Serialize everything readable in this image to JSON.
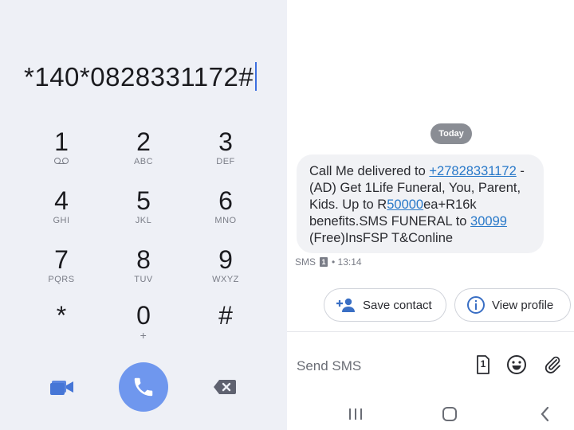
{
  "dialer": {
    "number": "*140*0828331172#",
    "keys": [
      {
        "digit": "1",
        "letters": ""
      },
      {
        "digit": "2",
        "letters": "ABC"
      },
      {
        "digit": "3",
        "letters": "DEF"
      },
      {
        "digit": "4",
        "letters": "GHI"
      },
      {
        "digit": "5",
        "letters": "JKL"
      },
      {
        "digit": "6",
        "letters": "MNO"
      },
      {
        "digit": "7",
        "letters": "PQRS"
      },
      {
        "digit": "8",
        "letters": "TUV"
      },
      {
        "digit": "9",
        "letters": "WXYZ"
      },
      {
        "digit": "*",
        "letters": ""
      },
      {
        "digit": "0",
        "letters": "+"
      },
      {
        "digit": "#",
        "letters": ""
      }
    ],
    "icons": {
      "voicemail": "voicemail-icon",
      "video": "video-call-icon",
      "call": "phone-call-icon",
      "delete": "backspace-icon"
    },
    "colors": {
      "call_button": "#6f97ee",
      "accent": "#3c6fe0"
    }
  },
  "sms": {
    "date_chip": "Today",
    "message": {
      "part1": "Call Me delivered to ",
      "link1": "+27828331172",
      "part2": " -(AD) Get 1Life Funeral, You, Parent, Kids. Up to R",
      "link2": "50000",
      "part3": "ea+R16k benefits.SMS FUNERAL to ",
      "link3": "30099",
      "part4": " (Free)InsFSP T&Conline"
    },
    "meta": {
      "type": "SMS",
      "sim": "1",
      "time": "• 13:14"
    },
    "actions": {
      "save_contact": "Save contact",
      "view_profile": "View profile"
    },
    "compose": {
      "placeholder": "Send SMS",
      "sim": "1"
    },
    "colors": {
      "link": "#2979c9",
      "action_icon": "#3a6fc4"
    }
  }
}
